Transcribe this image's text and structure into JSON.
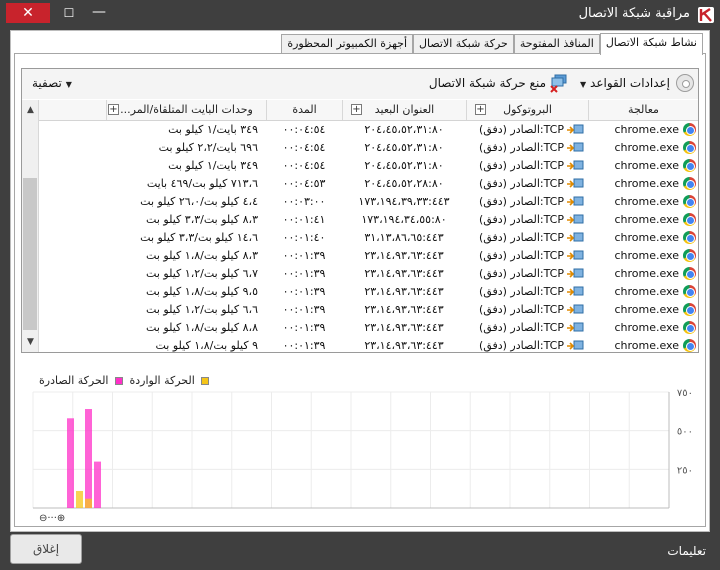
{
  "window": {
    "title": "مراقبة شبكة الاتصال",
    "close_glyph": "✕",
    "maximize_glyph": "☐",
    "minimize_glyph": "—"
  },
  "tabs": [
    {
      "label": "نشاط شبكة الاتصال",
      "active": true
    },
    {
      "label": "المنافذ المفتوحة",
      "active": false
    },
    {
      "label": "حركة شبكة الاتصال",
      "active": false
    },
    {
      "label": "أجهزة الكمبيوتر المحظورة",
      "active": false
    }
  ],
  "toolbar": {
    "rules_label": "إعدادات القواعد",
    "block_label": "منع حركة شبكة الاتصال",
    "filter_label": "تصفية",
    "caret": "▼"
  },
  "columns": {
    "process": "معالجة",
    "protocol": "البروتوكول",
    "remote": "العنوان البعيد",
    "duration": "المدة",
    "bytes": "وحدات البايت المتلقاة/المر..."
  },
  "scroll": {
    "up": "▲",
    "down": "▼"
  },
  "rows": [
    {
      "process": "chrome.exe",
      "protocol": "TCP:الصادر (دفق)",
      "remote": "٢٠٤،٤٥،٥٢،٣١:٨٠",
      "duration": "٠٠:٠٤:٥٤",
      "bytes": "٣٤٩ بايت/١ كيلو بت"
    },
    {
      "process": "chrome.exe",
      "protocol": "TCP:الصادر (دفق)",
      "remote": "٢٠٤،٤٥،٥٢،٣١:٨٠",
      "duration": "٠٠:٠٤:٥٤",
      "bytes": "٦٩٦ بايت/٢،٢ كيلو بت"
    },
    {
      "process": "chrome.exe",
      "protocol": "TCP:الصادر (دفق)",
      "remote": "٢٠٤،٤٥،٥٢،٣١:٨٠",
      "duration": "٠٠:٠٤:٥٤",
      "bytes": "٣٤٩ بايت/١ كيلو بت"
    },
    {
      "process": "chrome.exe",
      "protocol": "TCP:الصادر (دفق)",
      "remote": "٢٠٤،٤٥،٥٢،٢٨:٨٠",
      "duration": "٠٠:٠٤:٥٣",
      "bytes": "٧١٣،٦ كيلو بت/٤٦٩ بايت"
    },
    {
      "process": "chrome.exe",
      "protocol": "TCP:الصادر (دفق)",
      "remote": "١٧٣،١٩٤،٣٩،٣٣:٤٤٣",
      "duration": "٠٠:٠٣:٠٠",
      "bytes": "٤،٤ كيلو بت/٢٦،٠ كيلو بت"
    },
    {
      "process": "chrome.exe",
      "protocol": "TCP:الصادر (دفق)",
      "remote": "١٧٣،١٩٤،٣٤،٥٥:٨٠",
      "duration": "٠٠:٠١:٤١",
      "bytes": "٨،٣ كيلو بت/٣،٣ كيلو بت"
    },
    {
      "process": "chrome.exe",
      "protocol": "TCP:الصادر (دفق)",
      "remote": "٣١،١٣،٨٦،٦٥:٤٤٣",
      "duration": "٠٠:٠١:٤٠",
      "bytes": "١٤،٦ كيلو بت/٣،٣ كيلو بت"
    },
    {
      "process": "chrome.exe",
      "protocol": "TCP:الصادر (دفق)",
      "remote": "٢٣،١٤،٩٣،٦٣:٤٤٣",
      "duration": "٠٠:٠١:٣٩",
      "bytes": "٨،٣ كيلو بت/١،٨ كيلو بت"
    },
    {
      "process": "chrome.exe",
      "protocol": "TCP:الصادر (دفق)",
      "remote": "٢٣،١٤،٩٣،٦٣:٤٤٣",
      "duration": "٠٠:٠١:٣٩",
      "bytes": "٦،٧ كيلو بت/١،٢ كيلو بت"
    },
    {
      "process": "chrome.exe",
      "protocol": "TCP:الصادر (دفق)",
      "remote": "٢٣،١٤،٩٣،٦٣:٤٤٣",
      "duration": "٠٠:٠١:٣٩",
      "bytes": "٩،٥ كيلو بت/١،٨ كيلو بت"
    },
    {
      "process": "chrome.exe",
      "protocol": "TCP:الصادر (دفق)",
      "remote": "٢٣،١٤،٩٣،٦٣:٤٤٣",
      "duration": "٠٠:٠١:٣٩",
      "bytes": "٦،٦ كيلو بت/١،٢ كيلو بت"
    },
    {
      "process": "chrome.exe",
      "protocol": "TCP:الصادر (دفق)",
      "remote": "٢٣،١٤،٩٣،٦٣:٤٤٣",
      "duration": "٠٠:٠١:٣٩",
      "bytes": "٨،٨ كيلو بت/١،٨ كيلو بت"
    },
    {
      "process": "chrome.exe",
      "protocol": "TCP:الصادر (دفق)",
      "remote": "٢٣،١٤،٩٣،٦٣:٤٤٣",
      "duration": "٠٠:٠١:٣٩",
      "bytes": "٩ كيلو بت/١،٨ كيلو بت"
    }
  ],
  "chart_data": {
    "type": "bar",
    "legend": [
      "الحركة الصادرة",
      "الحركة الواردة"
    ],
    "colors": {
      "incoming": "#ff2fc8",
      "outgoing": "#f5c518"
    },
    "ytick_labels": [
      "٧٥٠",
      "٥٠٠",
      "٢٥٠"
    ],
    "ylim": [
      0,
      750
    ],
    "bars": [
      {
        "slot": 0,
        "incoming": 580,
        "outgoing": 0
      },
      {
        "slot": 1,
        "incoming": 0,
        "outgoing": 110
      },
      {
        "slot": 2,
        "incoming": 640,
        "outgoing": 60
      },
      {
        "slot": 3,
        "incoming": 300,
        "outgoing": 0
      }
    ],
    "zoom_label": "⊖···⊕"
  },
  "footer": {
    "close_button": "إغلاق",
    "help_link": "تعليمات"
  }
}
